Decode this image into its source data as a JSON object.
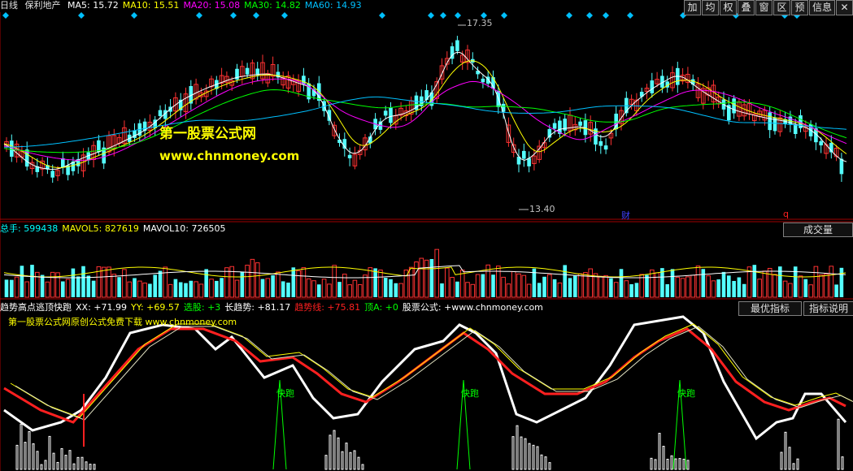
{
  "window": {
    "period": "日线",
    "stock_name": "保利地产"
  },
  "ma_header": [
    {
      "label": "MA5: 15.72",
      "color": "#ffffff"
    },
    {
      "label": "MA10: 15.51",
      "color": "#ffff00"
    },
    {
      "label": "MA20: 15.08",
      "color": "#ff00ff"
    },
    {
      "label": "MA30: 14.82",
      "color": "#00ff00"
    },
    {
      "label": "MA60: 14.93",
      "color": "#00c0ff"
    }
  ],
  "toolbar": [
    "加",
    "均",
    "权",
    "叠",
    "窗",
    "区",
    "预",
    "信息"
  ],
  "price_annotations": {
    "high": "17.35",
    "low": "13.40",
    "finance_mark": "财",
    "q_mark": "q"
  },
  "watermark": {
    "title": "第一股票公式网",
    "url": "www.chnmoney.com",
    "sub_note": "第一股票公式网原创公式免费下载 www.chnmoney.com"
  },
  "volume_header": [
    {
      "label": "总手: 599438",
      "color": "#00ffff"
    },
    {
      "label": "MAVOL5: 827619",
      "color": "#ffff00"
    },
    {
      "label": "MAVOL10: 726505",
      "color": "#ffffff"
    }
  ],
  "volume_button": "成交量",
  "indicator_header": [
    {
      "label": "趋势高点逃顶快跑",
      "color": "#ffffff"
    },
    {
      "label": "XX: +71.99",
      "color": "#ffffff"
    },
    {
      "label": "YY: +69.57",
      "color": "#ffff00"
    },
    {
      "label": "选股: +3",
      "color": "#00ff00"
    },
    {
      "label": "长趋势: +81.17",
      "color": "#ffffff"
    },
    {
      "label": "趋势线: +75.81",
      "color": "#ff2020"
    },
    {
      "label": "顶A: +0",
      "color": "#00ff00"
    },
    {
      "label": "股票公式: +www.chnmoney.com",
      "color": "#ffffff"
    }
  ],
  "indicator_buttons": [
    "最优指标",
    "指标说明"
  ],
  "run_signal_label": "快跑",
  "colors": {
    "up": "#ff3232",
    "down": "#54ffff",
    "ma5": "#ffffff",
    "ma10": "#ffff00",
    "ma20": "#ff00ff",
    "ma30": "#00ff00",
    "ma60": "#00c0ff",
    "trend": "#ff2020",
    "signal": "#00ff00",
    "diamond": "#00c0ff"
  }
}
